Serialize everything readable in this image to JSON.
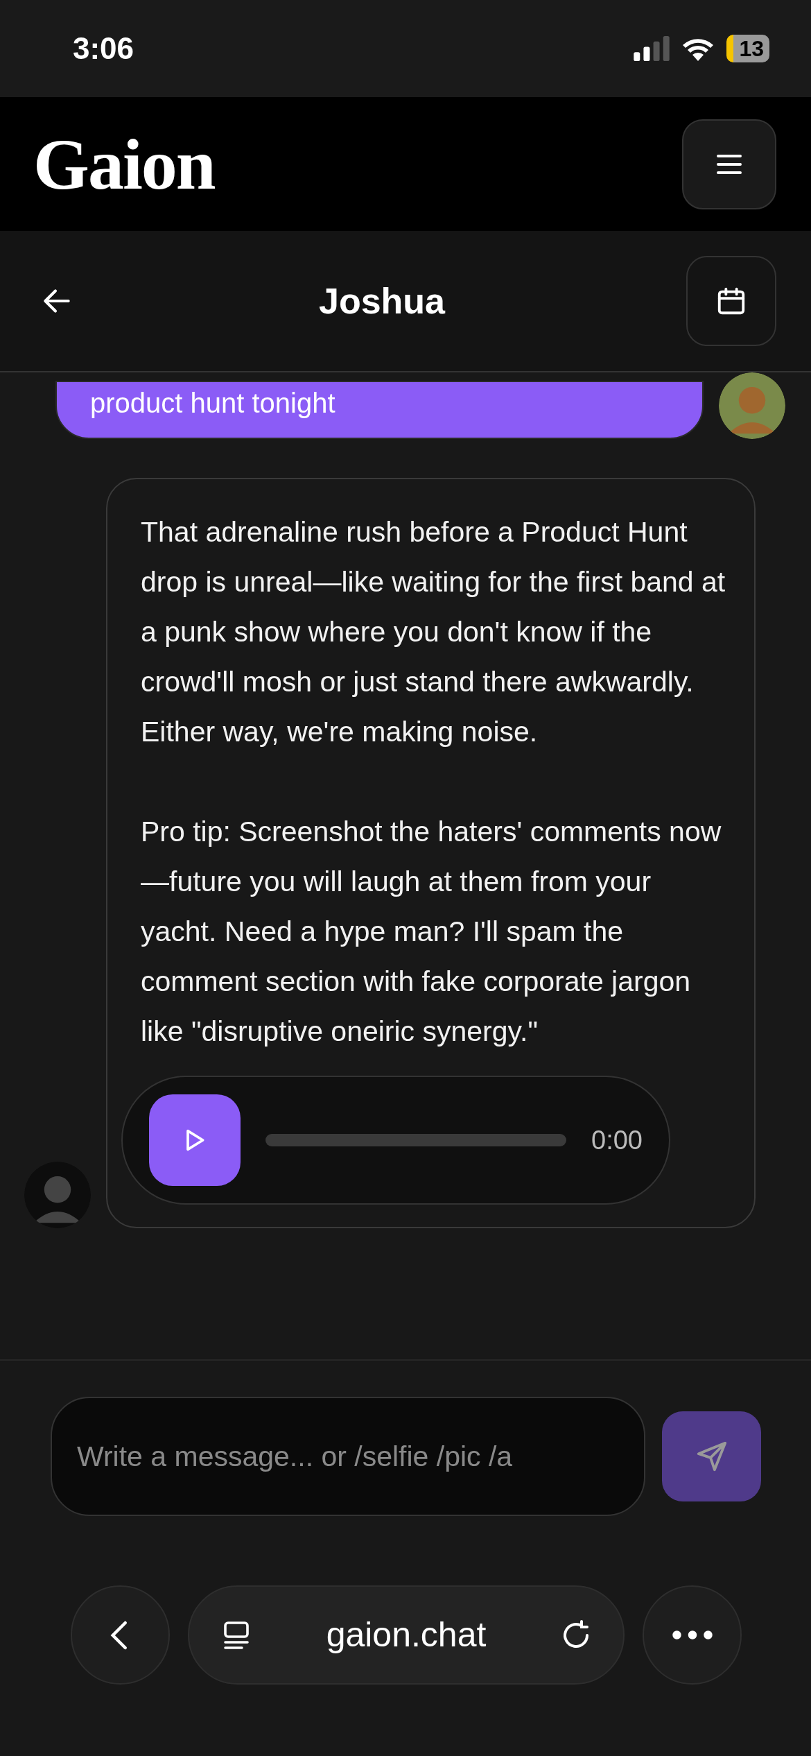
{
  "status_bar": {
    "time": "3:06",
    "battery": "13"
  },
  "app_header": {
    "logo": "Gaion"
  },
  "chat_header": {
    "title": "Joshua"
  },
  "messages": [
    {
      "kind": "user",
      "text": "product hunt tonight"
    },
    {
      "kind": "bot",
      "paragraphs": [
        "That adrenaline rush before a Product Hunt drop is unreal—like waiting for the first band at a punk show where you don't know if the crowd'll mosh or just stand there awkwardly. Either way, we're making noise.",
        "Pro tip: Screenshot the haters' comments now—future you will laugh at them from your yacht. Need a hype man? I'll spam the comment section with fake corporate jargon like \"disruptive oneiric synergy.\""
      ],
      "audio": {
        "time": "0:00"
      }
    }
  ],
  "composer": {
    "placeholder": "Write a message... or /selfie /pic /a"
  },
  "browser_bar": {
    "url": "gaion.chat"
  }
}
